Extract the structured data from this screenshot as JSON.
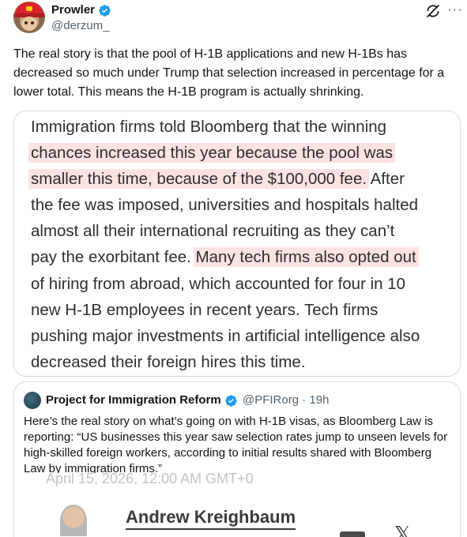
{
  "post": {
    "author_name": "Prowler",
    "author_handle": "@derzum_",
    "text": "The real story is that the pool of H-1B applications and new H-1Bs has decreased so much under Trump that selection increased in percentage for a lower total. This means the H-1B program is actually shrinking.",
    "more_label": "···"
  },
  "image_card": {
    "lines": [
      {
        "before": "Immigration firms told Bloomberg that the winning",
        "highlight": "",
        "after": ""
      },
      {
        "before": "",
        "highlight": "chances increased this year because the pool was",
        "after": ""
      },
      {
        "before": "",
        "highlight": "smaller this time, because of the $100,000 fee.",
        "after": " After"
      },
      {
        "before": "the fee was imposed, universities and hospitals halted",
        "highlight": "",
        "after": ""
      },
      {
        "before": "almost all their international recruiting as they can’t",
        "highlight": "",
        "after": ""
      },
      {
        "before": "pay the exorbitant fee. ",
        "highlight": "Many tech firms also opted out",
        "after": ""
      },
      {
        "before": "of hiring from abroad, which accounted for four in 10",
        "highlight": "",
        "after": ""
      },
      {
        "before": "new H-1B employees in recent years. Tech firms",
        "highlight": "",
        "after": ""
      },
      {
        "before": "pushing major investments in artificial intelligence also",
        "highlight": "",
        "after": ""
      },
      {
        "before": "decreased their foreign hires this time.",
        "highlight": "",
        "after": ""
      }
    ],
    "highlight_color": "#fde2e2"
  },
  "quoted_post": {
    "author_name": "Project for Immigration Reform",
    "author_handle": "@PFIRorg · 19h",
    "text": "Here’s the real story on what’s going on with H-1B visas, as Bloomberg Law is reporting: “US businesses this year saw selection rates jump to unseen levels for high-skilled foreign workers, according to initial results shared with Bloomberg Law by immigration firms.”",
    "embed": {
      "faded_line": "April 15, 2026, 12:00 AM GMT+0",
      "author": "Andrew Kreighbaum",
      "share_icon": "𝕏"
    }
  },
  "colors": {
    "verified": "#1d9bf0",
    "text_primary": "#0f1419",
    "text_secondary": "#536471",
    "border": "#cfd9de"
  },
  "icons": [
    "verified-badge-icon",
    "grok-icon",
    "more-icon",
    "x-logo-icon"
  ]
}
